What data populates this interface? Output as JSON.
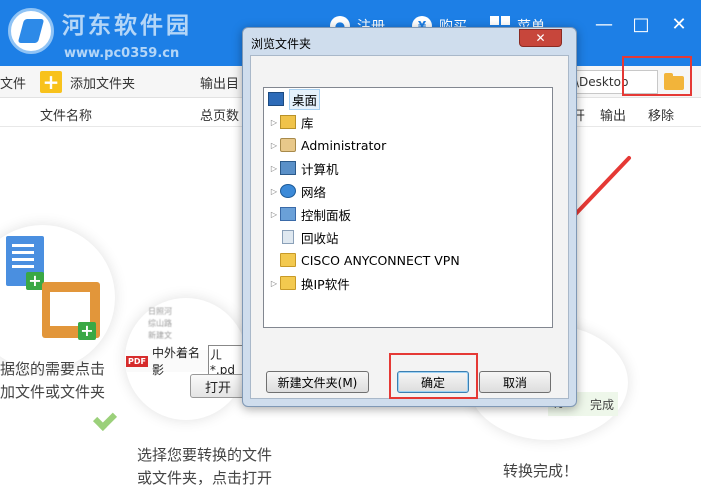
{
  "app": {
    "brand": "河东软件园",
    "brand_url": "www.pc0359.cn",
    "header": {
      "register_label": "注册",
      "buy_label": "购买",
      "menu_label": "菜单",
      "yen_glyph": "¥"
    },
    "window_controls": {
      "minimize": "—",
      "maximize": "□",
      "close": "✕"
    }
  },
  "toolbar": {
    "add_file_label": "文件",
    "add_folder_label": "添加文件夹",
    "output_dir_label": "输出目",
    "output_path_value": "\\Desktop"
  },
  "columns": {
    "name": "文件名称",
    "pages": "总页数",
    "open": "开",
    "output": "输出",
    "remove": "移除"
  },
  "illustration": {
    "step1_line1": "据您的需要点击",
    "step1_line2": "加文件或文件夹",
    "step2_line1": "选择您要转换的文件",
    "step2_line2": "或文件夹，点击打开",
    "step3": "转换完成！",
    "pdf_tag": "PDF",
    "pdf_file": "中外着名影",
    "pdf_ext": "ㄦ*.pd",
    "open_button": "打开",
    "progress_text": "%",
    "progress_done": "完成",
    "blurred_items": [
      "日照河",
      "综山路",
      "新建文"
    ]
  },
  "dialog": {
    "title": "浏览文件夹",
    "close_glyph": "✕",
    "tree": [
      {
        "label": "桌面",
        "icon": "desktop-icon",
        "expandable": false,
        "level": 0,
        "selected": true
      },
      {
        "label": "库",
        "icon": "library-icon",
        "expandable": true,
        "level": 1
      },
      {
        "label": "Administrator",
        "icon": "user-folder-icon",
        "expandable": true,
        "level": 1
      },
      {
        "label": "计算机",
        "icon": "computer-icon",
        "expandable": true,
        "level": 1
      },
      {
        "label": "网络",
        "icon": "network-icon",
        "expandable": true,
        "level": 1
      },
      {
        "label": "控制面板",
        "icon": "control-panel-icon",
        "expandable": true,
        "level": 1
      },
      {
        "label": "回收站",
        "icon": "recycle-bin-icon",
        "expandable": false,
        "level": 1
      },
      {
        "label": "CISCO ANYCONNECT VPN",
        "icon": "folder-icon",
        "expandable": false,
        "level": 1
      },
      {
        "label": "换IP软件",
        "icon": "folder-icon",
        "expandable": true,
        "level": 1
      }
    ],
    "new_folder_button": "新建文件夹(M)",
    "ok_button": "确定",
    "cancel_button": "取消"
  },
  "colors": {
    "titlebar": "#1d7fe6",
    "highlight_box": "#e53935",
    "folder": "#f2b43a"
  }
}
